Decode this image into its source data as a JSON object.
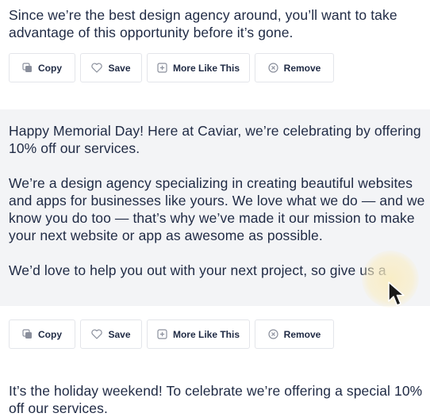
{
  "posts": [
    {
      "paragraphs": [
        "Since we’re the best design agency around, you’ll want to take advantage of this opportunity before it’s gone."
      ]
    },
    {
      "paragraphs": [
        "Happy Memorial Day! Here at Caviar, we’re celebrating by offering 10% off our services.",
        "We’re a design agency specializing in creating beautiful websites and apps for businesses like yours. We love what we do — and we know you do too — that’s why we’ve made it our mission to make your next website or app as awesome as possible.",
        "We’d love to help you out with your next project, so give us a"
      ]
    },
    {
      "paragraphs": [
        "It’s the holiday weekend! To celebrate we’re offering a special 10% off our services."
      ]
    }
  ],
  "actions": {
    "copy": "Copy",
    "save": "Save",
    "more_like_this": "More Like This",
    "remove": "Remove"
  },
  "icons": {
    "copy": "copy-icon",
    "save": "heart-icon",
    "more": "plus-square-icon",
    "remove": "x-circle-icon",
    "cursor": "mouse-pointer-icon"
  },
  "colors": {
    "text": "#1f2a44",
    "highlight_bg": "#f3f4f6",
    "border": "#e3e5ea"
  }
}
